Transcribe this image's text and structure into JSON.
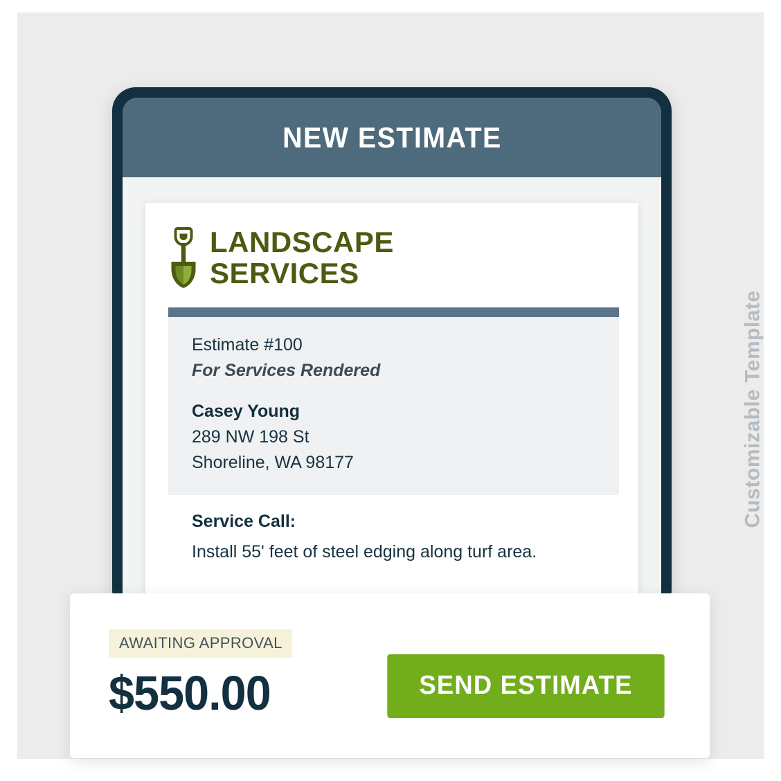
{
  "banner": {
    "vertical_label": "Customizable Template"
  },
  "app": {
    "header_title": "NEW ESTIMATE"
  },
  "document": {
    "logo": {
      "icon": "shovel-icon",
      "line1": "LANDSCAPE",
      "line2": "SERVICES"
    },
    "meta": {
      "estimate_number": "Estimate #100",
      "subtitle": "For Services Rendered",
      "customer_name": "Casey Young",
      "address_line1": "289 NW 198 St",
      "address_line2": "Shoreline, WA 98177"
    },
    "service": {
      "title": "Service Call:",
      "description": "Install 55' feet of steel edging along turf area."
    }
  },
  "summary": {
    "status": "AWAITING APPROVAL",
    "amount": "$550.00",
    "send_label": "SEND ESTIMATE"
  },
  "colors": {
    "page_background": "#ffffff",
    "backdrop": "#ececec",
    "device_frame": "#12303f",
    "app_header": "#4d6b7c",
    "doc_divider": "#5c7489",
    "meta_panel": "#f0f1f2",
    "logo_green": "#4e5a12",
    "shovel_blade": "#8fae3a",
    "accent_green": "#72ad1c",
    "badge_background": "#f6f2da",
    "badge_text": "#44505a",
    "price_text": "#12303f",
    "vertical_label": "#b4bcc2"
  }
}
